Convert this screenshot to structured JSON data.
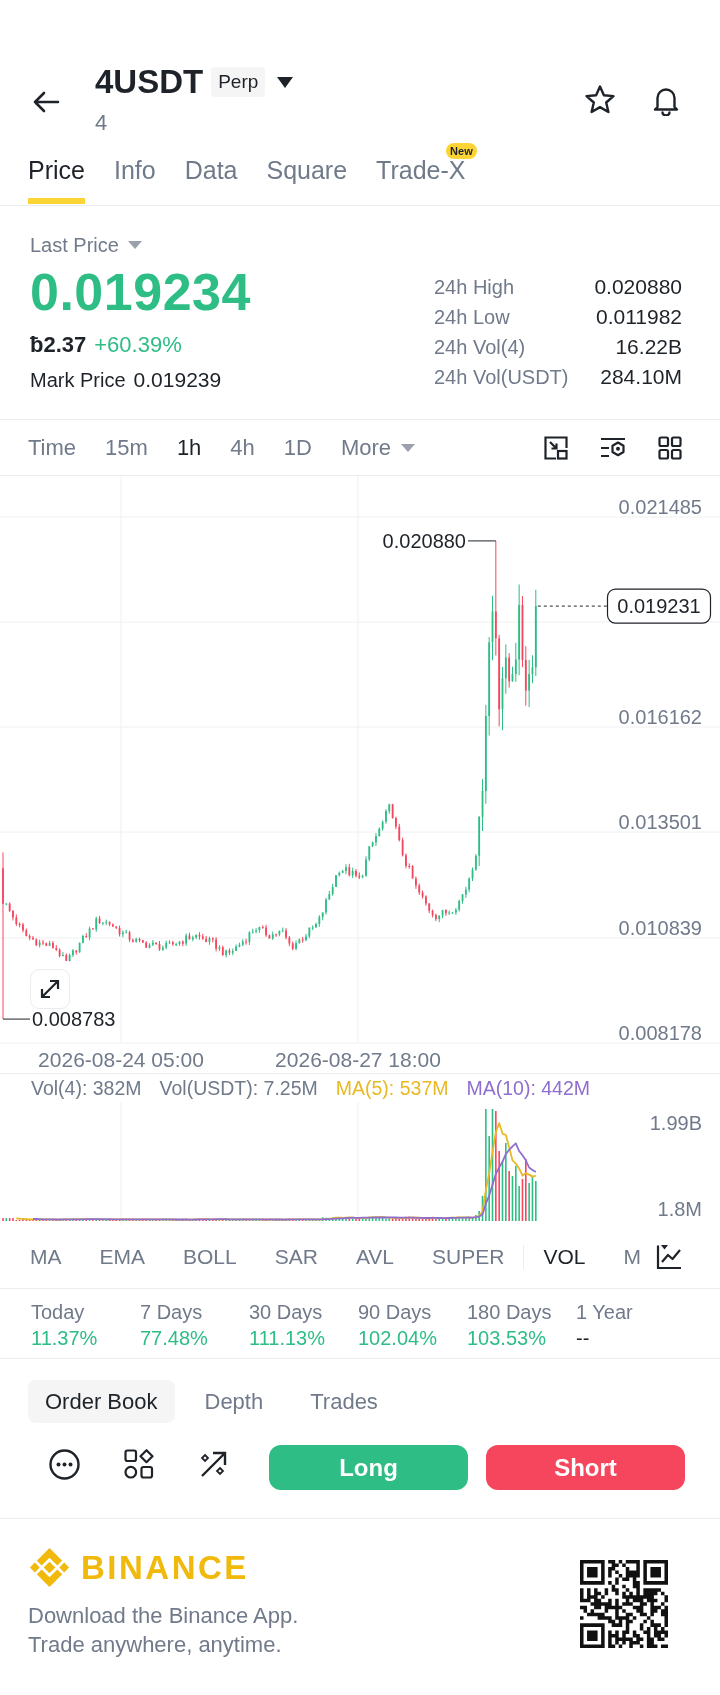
{
  "header": {
    "symbol": "4USDT",
    "contract_type": "Perp",
    "base_asset": "4"
  },
  "tabs": [
    {
      "label": "Price",
      "selected": true
    },
    {
      "label": "Info",
      "selected": false
    },
    {
      "label": "Data",
      "selected": false
    },
    {
      "label": "Square",
      "selected": false
    },
    {
      "label": "Trade-X",
      "selected": false,
      "badge": "New"
    }
  ],
  "price_panel": {
    "price_type": "Last Price",
    "last_price": "0.019234",
    "local_price": "ƀ2.37",
    "change": "+60.39%",
    "mark_price_label": "Mark Price",
    "mark_price": "0.019239",
    "stats": [
      {
        "label": "24h High",
        "value": "0.020880"
      },
      {
        "label": "24h Low",
        "value": "0.011982"
      },
      {
        "label": "24h Vol(4)",
        "value": "16.22B"
      },
      {
        "label": "24h Vol(USDT)",
        "value": "284.10M"
      }
    ]
  },
  "intervals": [
    {
      "label": "Time",
      "kind": "option",
      "selected": false
    },
    {
      "label": "15m",
      "kind": "option",
      "selected": false
    },
    {
      "label": "1h",
      "kind": "option",
      "selected": true
    },
    {
      "label": "4h",
      "kind": "option",
      "selected": false
    },
    {
      "label": "1D",
      "kind": "option",
      "selected": false
    },
    {
      "label": "More",
      "kind": "menu",
      "selected": false
    }
  ],
  "chart": {
    "price_axis": [
      "0.021485",
      "0.016162",
      "0.013501",
      "0.010839",
      "0.008178"
    ],
    "high_label": "0.020880",
    "low_label": "0.008783",
    "current_price": "0.019231",
    "time_axis": [
      "2026-08-24 05:00",
      "2026-08-27 18:00"
    ]
  },
  "volume": {
    "legend": [
      {
        "text": "Vol(4): 382M",
        "color": "#707a8a"
      },
      {
        "text": "Vol(USDT): 7.25M",
        "color": "#707a8a"
      },
      {
        "text": "MA(5): 537M",
        "color": "#e8b923"
      },
      {
        "text": "MA(10): 442M",
        "color": "#8e6fcf"
      }
    ],
    "axis": [
      "1.99B",
      "1.8M"
    ]
  },
  "main_indicators": [
    {
      "label": "MA",
      "selected": false
    },
    {
      "label": "EMA",
      "selected": false
    },
    {
      "label": "BOLL",
      "selected": false
    },
    {
      "label": "SAR",
      "selected": false
    },
    {
      "label": "AVL",
      "selected": false
    },
    {
      "label": "SUPER",
      "selected": false
    }
  ],
  "sub_indicators": [
    {
      "label": "VOL",
      "selected": true
    },
    {
      "label": "M",
      "selected": false
    }
  ],
  "returns": [
    {
      "period": "Today",
      "value": "11.37%",
      "color": "#2ebd85"
    },
    {
      "period": "7 Days",
      "value": "77.48%",
      "color": "#2ebd85"
    },
    {
      "period": "30 Days",
      "value": "111.13%",
      "color": "#2ebd85"
    },
    {
      "period": "90 Days",
      "value": "102.04%",
      "color": "#2ebd85"
    },
    {
      "period": "180 Days",
      "value": "103.53%",
      "color": "#2ebd85"
    },
    {
      "period": "1 Year",
      "value": "--",
      "color": "#1e2329"
    }
  ],
  "order_tabs": [
    {
      "label": "Order Book",
      "selected": true
    },
    {
      "label": "Depth",
      "selected": false
    },
    {
      "label": "Trades",
      "selected": false
    }
  ],
  "actions": [
    {
      "label": "Long",
      "kind": "long"
    },
    {
      "label": "Short",
      "kind": "short"
    }
  ],
  "footer": {
    "brand": "BINANCE",
    "lines": [
      "Download the Binance App.",
      "Trade anywhere, anytime."
    ]
  }
}
